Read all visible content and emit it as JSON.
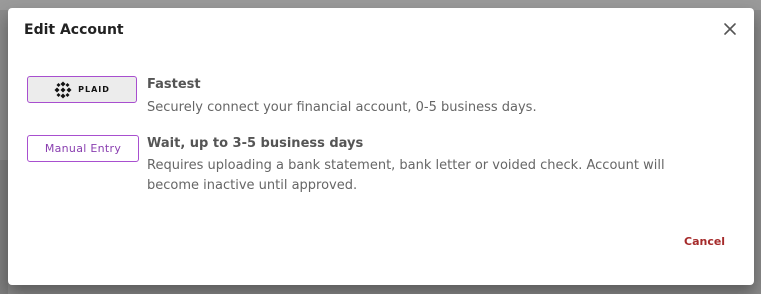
{
  "dialog": {
    "title": "Edit Account",
    "close_icon": "close-icon"
  },
  "options": [
    {
      "button_label": "PLAID",
      "button_icon": "plaid-logo-icon",
      "title": "Fastest",
      "description": "Securely connect your financial account, 0-5 business days."
    },
    {
      "button_label": "Manual Entry",
      "title": "Wait, up to 3-5 business days",
      "description": "Requires uploading a bank statement, bank letter or voided check. Account will become inactive until approved."
    }
  ],
  "footer": {
    "cancel_label": "Cancel"
  },
  "colors": {
    "accent": "#a84fcf",
    "cancel": "#a52a2a"
  }
}
